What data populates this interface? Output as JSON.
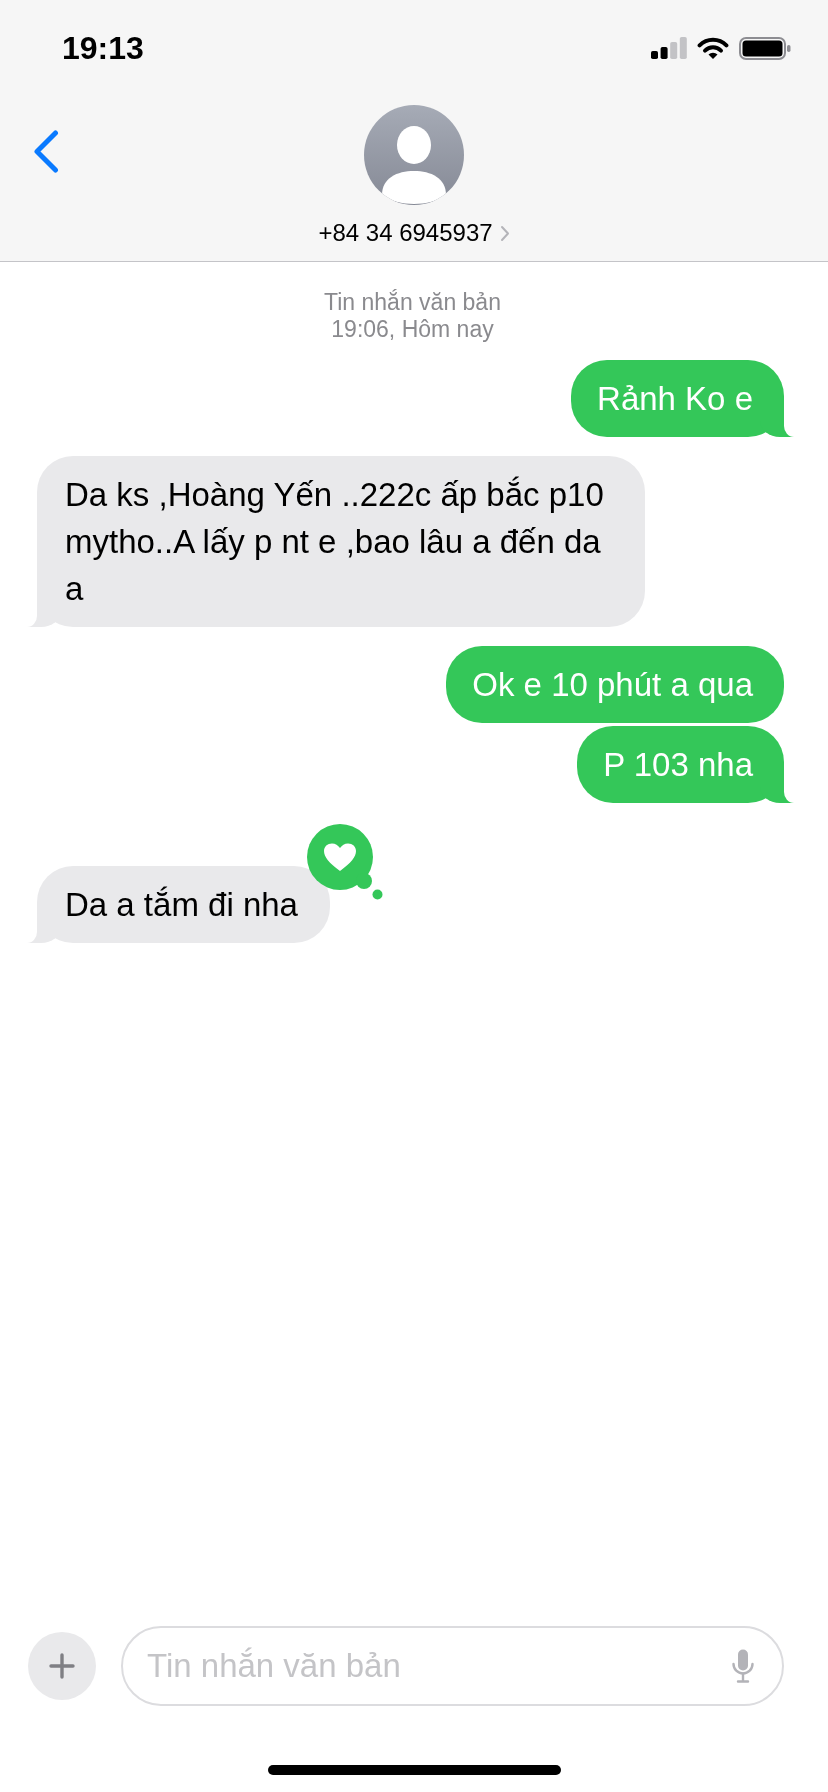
{
  "status_bar": {
    "time": "19:13"
  },
  "contact": {
    "name": "+84 34 6945937"
  },
  "thread": {
    "service": "Tin nhắn văn bản",
    "timestamp": "19:06, Hôm nay"
  },
  "messages": [
    {
      "kind": "sent",
      "text": "Rảnh Ko e",
      "tail": true
    },
    {
      "kind": "received",
      "text": "Da ks ,Hoàng Yến ..222c ấp bắc p10 mytho..A lấy p nt e ,bao lâu a đến da a",
      "tail": true
    },
    {
      "kind": "sent",
      "text": "Ok e 10 phút a qua",
      "tail": false
    },
    {
      "kind": "sent",
      "text": "P 103 nha",
      "tail": true
    },
    {
      "kind": "received",
      "text": "Da a tắm đi nha",
      "tail": true,
      "reaction": {
        "kind": "heart"
      }
    }
  ],
  "composer": {
    "placeholder": "Tin nhắn văn bản"
  }
}
